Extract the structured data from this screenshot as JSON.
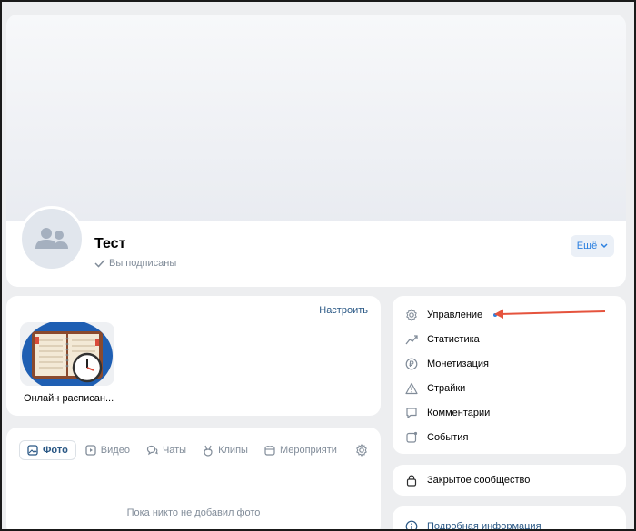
{
  "header": {
    "group_name": "Тест",
    "subscribed_label": "Вы подписаны",
    "more_label": "Ещё"
  },
  "apps": {
    "configure_label": "Настроить",
    "items": [
      {
        "label": "Онлайн расписан..."
      }
    ]
  },
  "media": {
    "tabs": [
      {
        "label": "Фото",
        "icon": "photo-icon",
        "active": true
      },
      {
        "label": "Видео",
        "icon": "video-icon"
      },
      {
        "label": "Чаты",
        "icon": "chats-icon"
      },
      {
        "label": "Клипы",
        "icon": "clips-icon"
      },
      {
        "label": "Мероприяти",
        "icon": "calendar-icon"
      }
    ],
    "empty_text": "Пока никто не добавил фото"
  },
  "sidebar_menu": {
    "items": [
      {
        "label": "Управление",
        "icon": "gear-icon",
        "has_dot": true
      },
      {
        "label": "Статистика",
        "icon": "stats-icon"
      },
      {
        "label": "Монетизация",
        "icon": "ruble-icon"
      },
      {
        "label": "Страйки",
        "icon": "warning-icon"
      },
      {
        "label": "Комментарии",
        "icon": "comment-icon"
      },
      {
        "label": "События",
        "icon": "events-icon"
      }
    ]
  },
  "closed_community": {
    "label": "Закрытое сообщество",
    "icon": "lock-icon"
  },
  "info": {
    "label": "Подробная информация",
    "icon": "info-icon"
  },
  "colors": {
    "accent": "#2d81e0",
    "link": "#2a5885",
    "muted": "#818c99",
    "annotation_arrow": "#e5533d",
    "page_bg": "#edeef0"
  }
}
